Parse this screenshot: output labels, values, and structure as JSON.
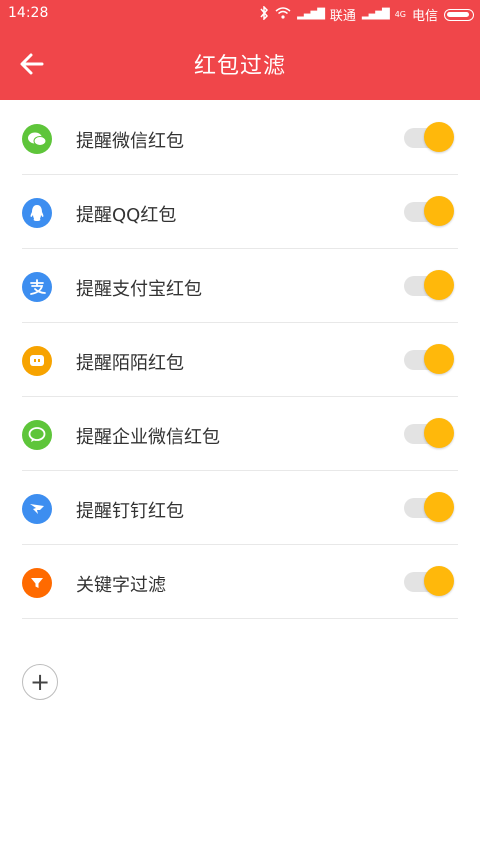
{
  "status": {
    "time": "14:28",
    "carrier1": "联通",
    "carrier2": "电信",
    "network2": "4G"
  },
  "header": {
    "title": "红包过滤"
  },
  "colors": {
    "primary": "#f0464a",
    "toggle_on": "#ffb80b",
    "wechat": "#5ec53a",
    "qq": "#3d8ef0",
    "alipay": "#3d8ef0",
    "momo": "#f7a300",
    "wecom": "#5ec53a",
    "dingtalk": "#3d8ef0",
    "keyword": "#ff6a00"
  },
  "items": [
    {
      "label": "提醒微信红包",
      "icon": "wechat-icon",
      "enabled": true
    },
    {
      "label": "提醒QQ红包",
      "icon": "qq-icon",
      "enabled": true
    },
    {
      "label": "提醒支付宝红包",
      "icon": "alipay-icon",
      "enabled": true
    },
    {
      "label": "提醒陌陌红包",
      "icon": "momo-icon",
      "enabled": true
    },
    {
      "label": "提醒企业微信红包",
      "icon": "wecom-icon",
      "enabled": true
    },
    {
      "label": "提醒钉钉红包",
      "icon": "dingtalk-icon",
      "enabled": true
    },
    {
      "label": "关键字过滤",
      "icon": "filter-icon",
      "enabled": true
    }
  ],
  "add_button": {
    "symbol": "+"
  }
}
